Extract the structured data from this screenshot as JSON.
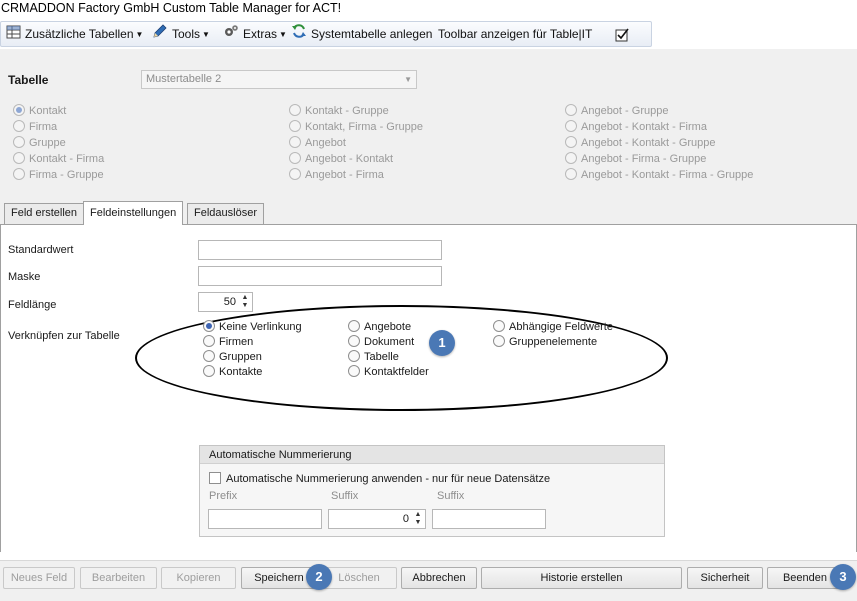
{
  "window": {
    "title": "CRMADDON Factory GmbH Custom Table Manager for ACT!"
  },
  "toolbar": {
    "additional_tables": "Zusätzliche Tabellen",
    "tools": "Tools",
    "extras": "Extras",
    "create_system_table": "Systemtabelle anlegen",
    "show_toolbar": "Toolbar anzeigen für Table|IT",
    "show_toolbar_checked": true
  },
  "table_section": {
    "label": "Tabelle",
    "selected_table": "Mustertabelle 2",
    "options": [
      {
        "label": "Kontakt",
        "checked": true
      },
      {
        "label": "Firma",
        "checked": false
      },
      {
        "label": "Gruppe",
        "checked": false
      },
      {
        "label": "Kontakt - Firma",
        "checked": false
      },
      {
        "label": "Firma - Gruppe",
        "checked": false
      },
      {
        "label": "Kontakt - Gruppe",
        "checked": false
      },
      {
        "label": "Kontakt, Firma - Gruppe",
        "checked": false
      },
      {
        "label": "Angebot",
        "checked": false
      },
      {
        "label": "Angebot - Kontakt",
        "checked": false
      },
      {
        "label": "Angebot - Firma",
        "checked": false
      },
      {
        "label": "Angebot - Gruppe",
        "checked": false
      },
      {
        "label": "Angebot - Kontakt - Firma",
        "checked": false
      },
      {
        "label": "Angebot - Kontakt - Gruppe",
        "checked": false
      },
      {
        "label": "Angebot - Firma - Gruppe",
        "checked": false
      },
      {
        "label": "Angebot - Kontakt - Firma - Gruppe",
        "checked": false
      }
    ]
  },
  "tabs": [
    {
      "label": "Feld erstellen",
      "active": false
    },
    {
      "label": "Feldeinstellungen",
      "active": true
    },
    {
      "label": "Feldauslöser",
      "active": false
    }
  ],
  "field_settings": {
    "default_value_label": "Standardwert",
    "default_value": "",
    "mask_label": "Maske",
    "mask": "",
    "length_label": "Feldlänge",
    "length": "50",
    "link_label": "Verknüpfen zur Tabelle",
    "link_options": [
      {
        "label": "Keine Verlinkung",
        "checked": true
      },
      {
        "label": "Firmen",
        "checked": false
      },
      {
        "label": "Gruppen",
        "checked": false
      },
      {
        "label": "Kontakte",
        "checked": false
      },
      {
        "label": "Angebote",
        "checked": false
      },
      {
        "label": "Dokument",
        "checked": false
      },
      {
        "label": "Tabelle",
        "checked": false
      },
      {
        "label": "Kontaktfelder",
        "checked": false
      },
      {
        "label": "Abhängige Feldwerte",
        "checked": false
      },
      {
        "label": "Gruppenelemente",
        "checked": false
      }
    ]
  },
  "auto_numbering": {
    "group_title": "Automatische Nummerierung",
    "apply_label": "Automatische Nummerierung anwenden - nur für neue Datensätze",
    "apply_checked": false,
    "prefix_label": "Prefix",
    "prefix": "",
    "suffix_label": "Suffix",
    "counter": "0",
    "suffix2_label": "Suffix",
    "suffix2": ""
  },
  "buttons": {
    "new_field": "Neues Feld",
    "edit": "Bearbeiten",
    "copy": "Kopieren",
    "save": "Speichern",
    "delete": "Löschen",
    "cancel": "Abbrechen",
    "history": "Historie erstellen",
    "security": "Sicherheit",
    "quit": "Beenden"
  },
  "annotations": {
    "badge_1": "1",
    "badge_2": "2",
    "badge_3": "3"
  },
  "colors": {
    "badge": "#4a78b5",
    "toolbar_border": "#c9d3e2",
    "panel": "#f0f0f0"
  }
}
